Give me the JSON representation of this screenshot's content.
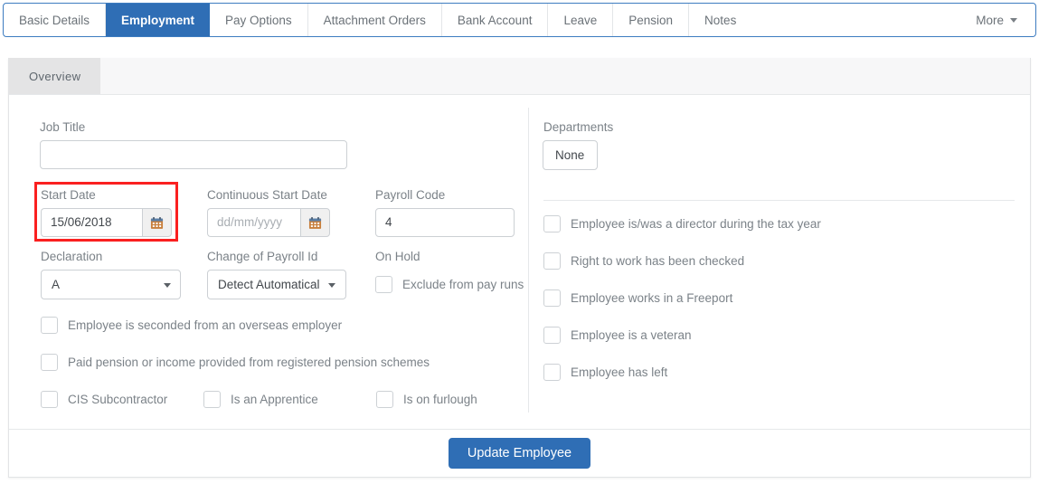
{
  "tabs": {
    "items": [
      {
        "label": "Basic Details",
        "active": false
      },
      {
        "label": "Employment",
        "active": true
      },
      {
        "label": "Pay Options",
        "active": false
      },
      {
        "label": "Attachment Orders",
        "active": false
      },
      {
        "label": "Bank Account",
        "active": false
      },
      {
        "label": "Leave",
        "active": false
      },
      {
        "label": "Pension",
        "active": false
      },
      {
        "label": "Notes",
        "active": false
      }
    ],
    "more_label": "More"
  },
  "subtabs": {
    "items": [
      {
        "label": "Overview",
        "active": true
      }
    ]
  },
  "form": {
    "job_title": {
      "label": "Job Title",
      "value": "",
      "placeholder": ""
    },
    "start_date": {
      "label": "Start Date",
      "value": "15/06/2018",
      "placeholder": "dd/mm/yyyy",
      "highlighted": true
    },
    "continuous_start_date": {
      "label": "Continuous Start Date",
      "value": "",
      "placeholder": "dd/mm/yyyy"
    },
    "payroll_code": {
      "label": "Payroll Code",
      "value": "4",
      "placeholder": ""
    },
    "declaration": {
      "label": "Declaration",
      "value": "A"
    },
    "change_of_payroll_id": {
      "label": "Change of Payroll Id",
      "value": "Detect Automatical"
    },
    "on_hold": {
      "label": "On Hold",
      "checkbox_label": "Exclude from pay runs",
      "checked": false
    },
    "left_checkboxes": [
      {
        "label": "Employee is seconded from an overseas employer",
        "checked": false
      },
      {
        "label": "Paid pension or income provided from registered pension schemes",
        "checked": false
      },
      {
        "label": "CIS Subcontractor",
        "checked": false
      },
      {
        "label": "Is an Apprentice",
        "checked": false
      },
      {
        "label": "Is on furlough",
        "checked": false
      }
    ],
    "departments": {
      "label": "Departments",
      "value": "None"
    },
    "right_checkboxes": [
      {
        "label": "Employee is/was a director during the tax year",
        "checked": false
      },
      {
        "label": "Right to work has been checked",
        "checked": false
      },
      {
        "label": "Employee works in a Freeport",
        "checked": false
      },
      {
        "label": "Employee is a veteran",
        "checked": false
      },
      {
        "label": "Employee has left",
        "checked": false
      }
    ]
  },
  "footer": {
    "submit_label": "Update Employee"
  },
  "colors": {
    "accent": "#2f6eb5",
    "highlight": "#fa2020",
    "label": "#7b8288",
    "border": "#ccd0d4"
  },
  "icons": {
    "calendar": "calendar-icon",
    "caret_down": "chevron-down-icon"
  }
}
